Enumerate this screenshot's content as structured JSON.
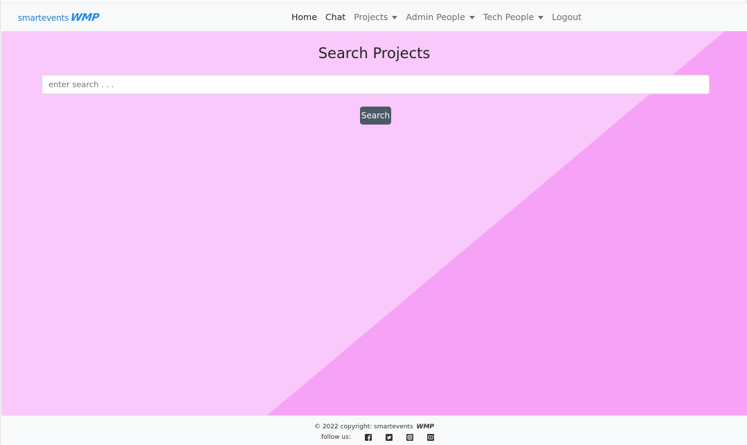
{
  "navbar": {
    "brand_small": "smartevents",
    "brand_logo": "WMP",
    "links": {
      "home": "Home",
      "chat": "Chat",
      "projects": "Projects",
      "admin_people": "Admin People",
      "tech_people": "Tech People",
      "logout": "Logout"
    }
  },
  "main": {
    "title": "Search Projects",
    "search_placeholder": "enter search . . .",
    "search_value": "",
    "search_button": "Search"
  },
  "footer": {
    "copyright": "© 2022 copyright: smartevents",
    "copyright_logo": "WMP",
    "follow_label": "follow us:",
    "social_icons": [
      "facebook-icon",
      "twitter-icon",
      "instagram-icon",
      "youtube-icon"
    ]
  },
  "colors": {
    "background_light": "#f8c9fa",
    "background_dark": "#f6a3f7",
    "brand_blue": "#1e88e5",
    "button": "#4d5866",
    "navbar_bg": "#f8f9fa"
  }
}
